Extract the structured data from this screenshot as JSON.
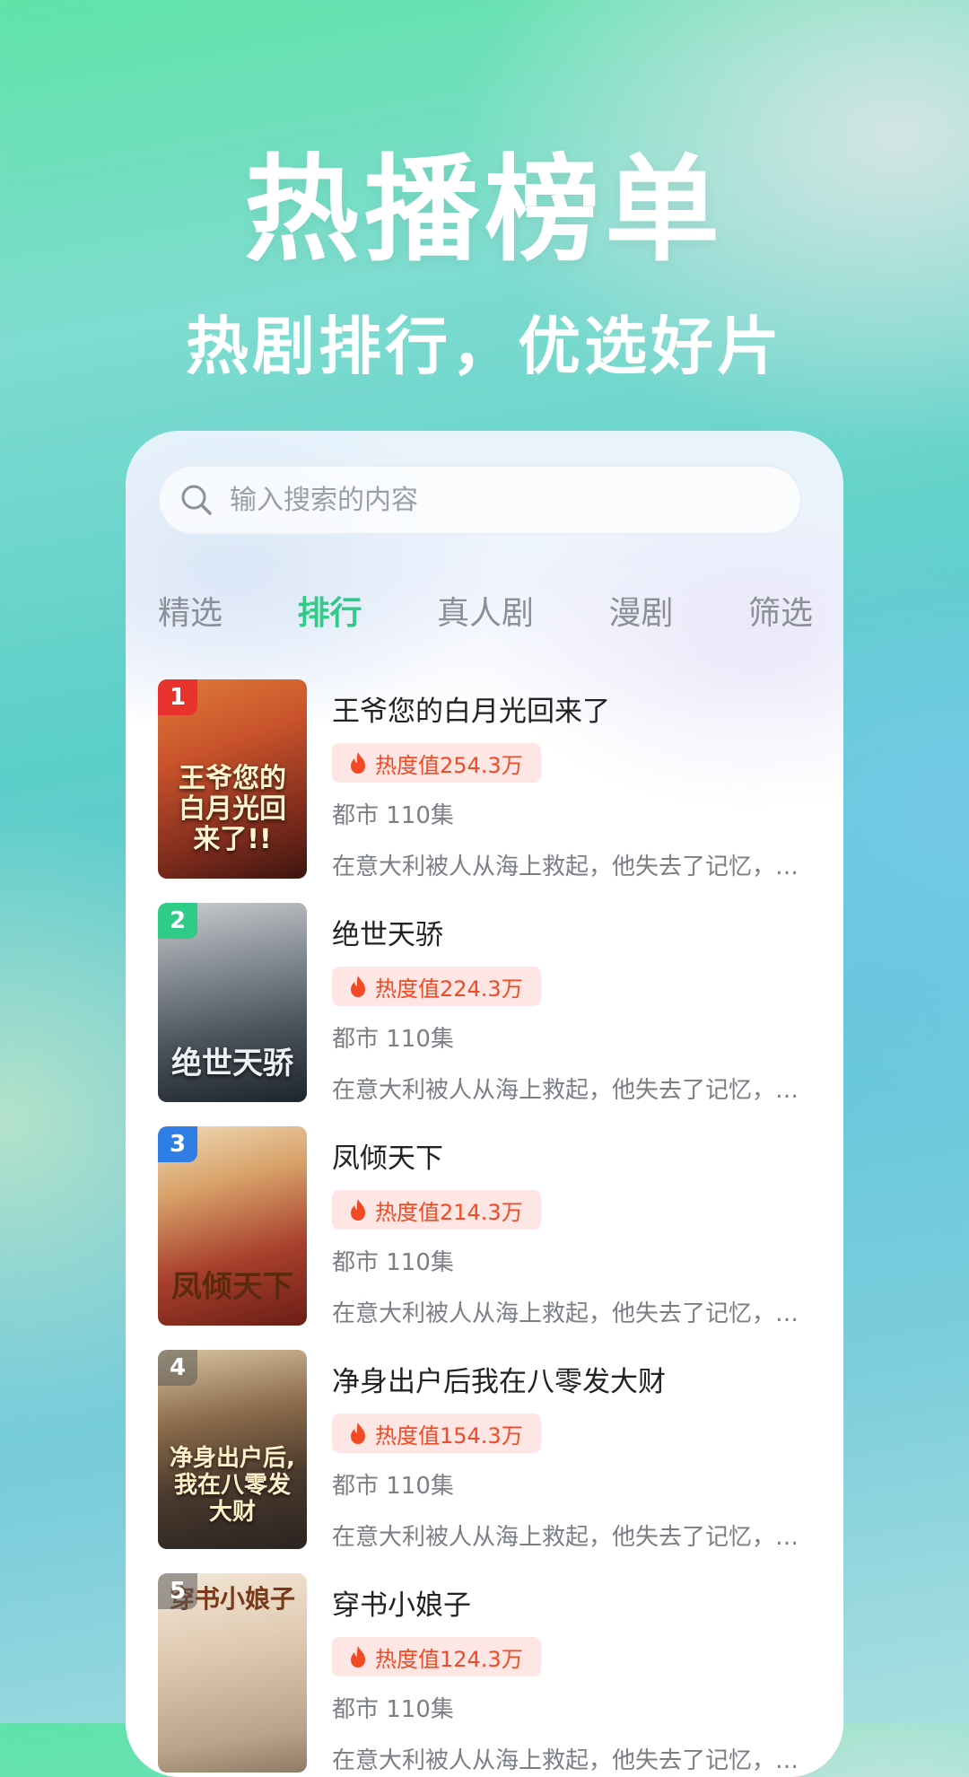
{
  "hero": {
    "title": "热播榜单",
    "subtitle": "热剧排行，优选好片"
  },
  "search": {
    "placeholder": "输入搜索的内容",
    "icon": "search-icon"
  },
  "tabs": [
    {
      "label": "精选",
      "active": false
    },
    {
      "label": "排行",
      "active": true
    },
    {
      "label": "真人剧",
      "active": false
    },
    {
      "label": "漫剧",
      "active": false
    },
    {
      "label": "筛选",
      "active": false
    }
  ],
  "colors": {
    "accent": "#2ecc87",
    "heat_text": "#f14a25",
    "heat_bg": "#fde6e3",
    "rank1": "#e8322e",
    "rank2": "#2ecc87",
    "rank3": "#2f7ee6",
    "rank_default": "#7a7f86"
  },
  "list": [
    {
      "rank": "1",
      "title": "王爷您的白月光回来了",
      "heat": "热度值254.3万",
      "meta": "都市 110集",
      "desc": "在意大利被人从海上救起，他失去了记忆，被一位好心的渔民收留",
      "cover_text": "王爷您的白月光回来了!!"
    },
    {
      "rank": "2",
      "title": "绝世天骄",
      "heat": "热度值224.3万",
      "meta": "都市 110集",
      "desc": "在意大利被人从海上救起，他失去了记忆，被一位好心的渔民收留",
      "cover_text": "绝世天骄"
    },
    {
      "rank": "3",
      "title": "凤倾天下",
      "heat": "热度值214.3万",
      "meta": "都市 110集",
      "desc": "在意大利被人从海上救起，他失去了记忆，被一位好心的渔民收留",
      "cover_text": "凤倾天下"
    },
    {
      "rank": "4",
      "title": "净身出户后我在八零发大财",
      "heat": "热度值154.3万",
      "meta": "都市 110集",
      "desc": "在意大利被人从海上救起，他失去了记忆，被一位好心的渔民收留",
      "cover_text": "净身出户后,我在八零发大财"
    },
    {
      "rank": "5",
      "title": "穿书小娘子",
      "heat": "热度值124.3万",
      "meta": "都市 110集",
      "desc": "在意大利被人从海上救起，他失去了记忆，被一位好心的渔民收留",
      "cover_text": "穿书小娘子"
    }
  ]
}
